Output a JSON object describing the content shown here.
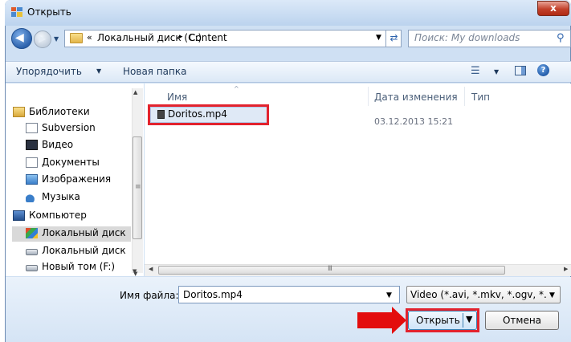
{
  "window": {
    "title": "Открыть",
    "close_label": "x"
  },
  "address_bar": {
    "more": "«",
    "crumbs": [
      "Локальный диск (C:)",
      "Content"
    ],
    "separator": "▸",
    "search_placeholder": "Поиск: My downloads"
  },
  "toolbar": {
    "organize_label": "Упорядочить",
    "new_folder_label": "Новая папка",
    "help_label": "?"
  },
  "nav": {
    "items": [
      {
        "label": "Библиотеки",
        "icon": "libraries-icon"
      },
      {
        "label": "Subversion",
        "icon": "document-icon"
      },
      {
        "label": "Видео",
        "icon": "video-icon"
      },
      {
        "label": "Документы",
        "icon": "documents-icon"
      },
      {
        "label": "Изображения",
        "icon": "pictures-icon"
      },
      {
        "label": "Музыка",
        "icon": "music-icon"
      },
      {
        "label": "Компьютер",
        "icon": "computer-icon"
      },
      {
        "label": "Локальный диск",
        "icon": "local-disk-icon"
      },
      {
        "label": "Локальный диск",
        "icon": "drive-icon"
      },
      {
        "label": "Новый том (F:)",
        "icon": "drive-icon"
      }
    ],
    "selected_index": 7
  },
  "file_list": {
    "columns": [
      "Имя",
      "Дата изменения",
      "Тип"
    ],
    "rows": [
      {
        "name": "Doritos.mp4",
        "modified": "03.12.2013 15:21",
        "type": ""
      }
    ]
  },
  "bottom": {
    "file_name_label": "Имя файла:",
    "file_name_value": "Doritos.mp4",
    "file_type_value": "Video (*.avi, *.mkv, *.ogv, *.wm",
    "open_label": "Открыть",
    "cancel_label": "Отмена"
  },
  "colors": {
    "highlight": "#e2232e",
    "accent_blue": "#2d63ad"
  }
}
